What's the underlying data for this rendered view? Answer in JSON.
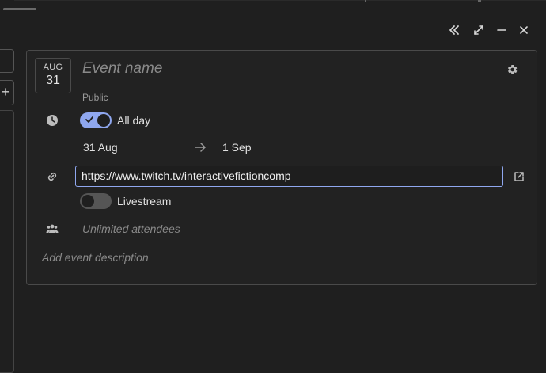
{
  "colors": {
    "accent": "#8fa7ef",
    "background": "#1f1f1f",
    "border": "#4a4a4a"
  },
  "window_controls": [
    {
      "icon": "collapse-double-chevron-icon"
    },
    {
      "icon": "expand-icon"
    },
    {
      "icon": "minimize-icon"
    },
    {
      "icon": "close-icon"
    }
  ],
  "sidebar": {
    "add_label": "+"
  },
  "event": {
    "date_month": "AUG",
    "date_day": "31",
    "name_placeholder": "Event name",
    "visibility": "Public",
    "all_day": {
      "label": "All day",
      "enabled": true
    },
    "start_date": "31 Aug",
    "end_date": "1 Sep",
    "location_url": "https://www.twitch.tv/interactivefictioncomp",
    "livestream": {
      "label": "Livestream",
      "enabled": false
    },
    "attendees_placeholder": "Unlimited attendees",
    "description_placeholder": "Add event description"
  }
}
